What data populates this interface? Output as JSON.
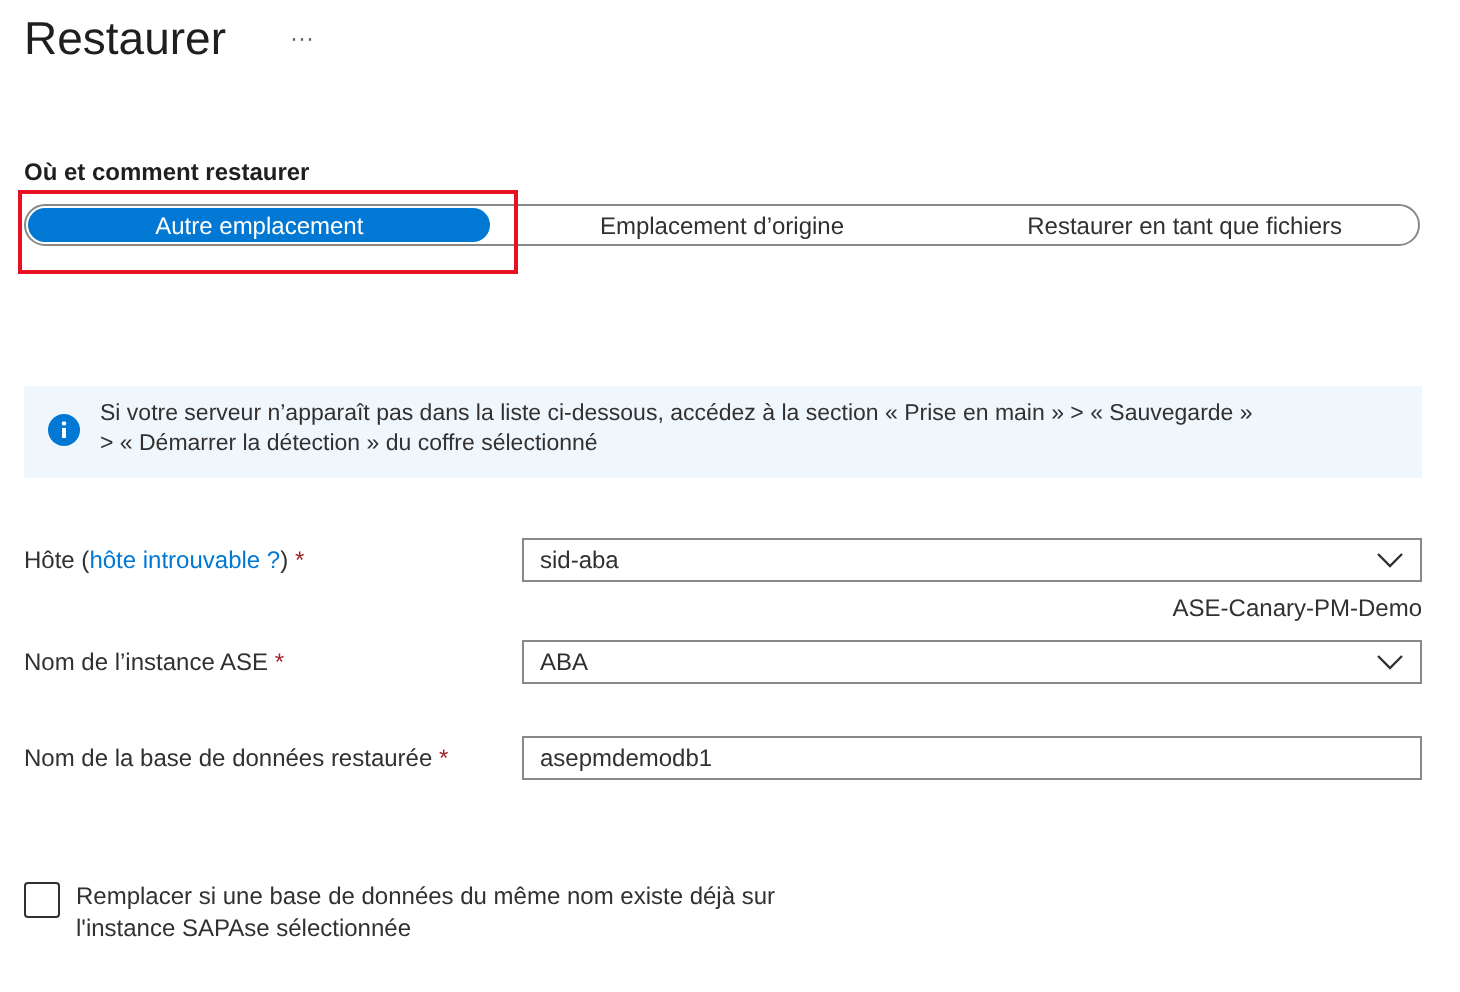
{
  "title": "Restaurer",
  "more_button": "···",
  "section_label": "Où et comment restaurer",
  "options": [
    {
      "label": "Autre emplacement",
      "selected": true,
      "highlighted": true
    },
    {
      "label": "Emplacement d’origine",
      "selected": false,
      "highlighted": false
    },
    {
      "label": "Restaurer en tant que fichiers",
      "selected": false,
      "highlighted": false
    }
  ],
  "info": {
    "text": "Si votre serveur n’apparaît pas dans la liste ci-dessous, accédez à la section « Prise en main » > « Sauvegarde » > « Démarrer la détection » du coffre sélectionné"
  },
  "fields": [
    {
      "kind": "dropdown",
      "label": "Hôte (",
      "link": "hôte introuvable ?",
      "label_end": ")",
      "required": true,
      "value": "sid-aba",
      "caption": "ASE-Canary-PM-Demo"
    },
    {
      "kind": "dropdown",
      "label": "Nom de l’instance ASE",
      "required": true,
      "value": "ABA"
    },
    {
      "kind": "text",
      "label": "Nom de la base de données restaurée",
      "required": true,
      "value": "asepmdemodb1"
    }
  ],
  "required_mark": "*",
  "checkbox": {
    "label": "Remplacer si une base de données du même nom existe déjà sur l'instance SAPAse sélectionnée",
    "checked": false
  }
}
